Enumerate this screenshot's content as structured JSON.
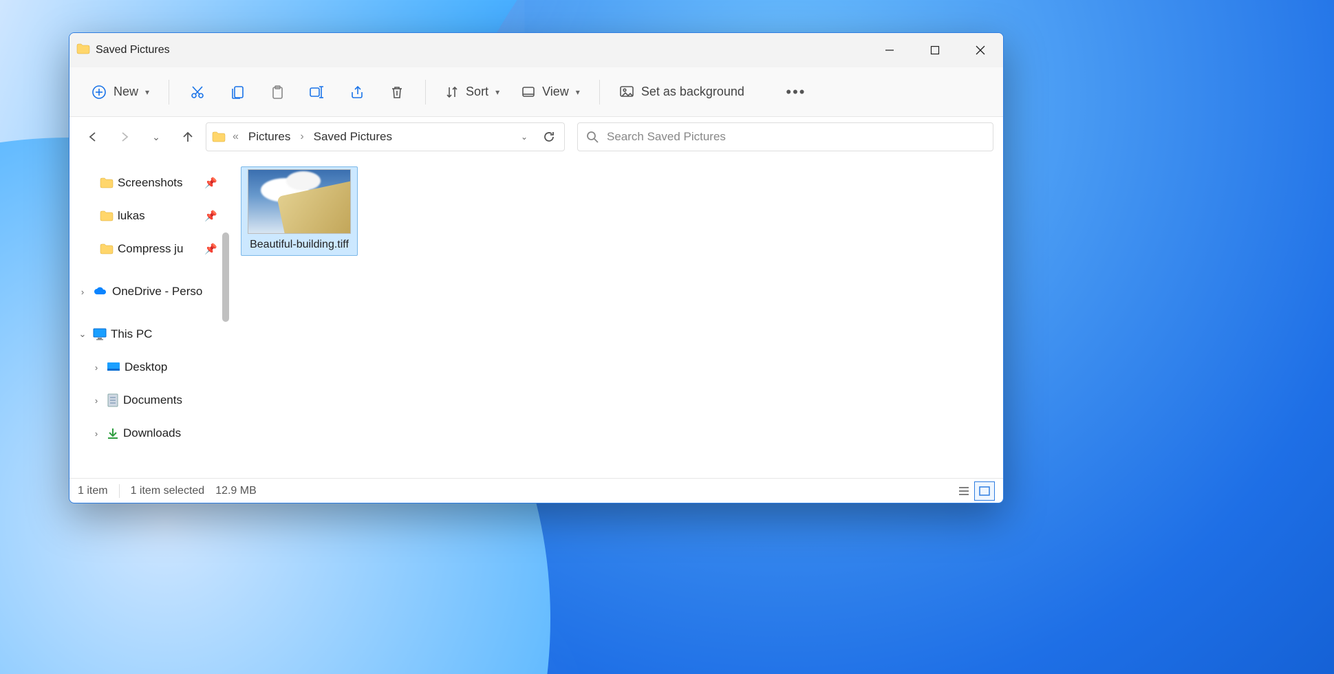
{
  "window": {
    "title": "Saved Pictures"
  },
  "toolbar": {
    "new_label": "New",
    "sort_label": "Sort",
    "view_label": "View",
    "set_bg_label": "Set as background"
  },
  "breadcrumbs": {
    "segments": [
      "Pictures",
      "Saved Pictures"
    ]
  },
  "search": {
    "placeholder": "Search Saved Pictures"
  },
  "nav": {
    "items": [
      {
        "label": "Screenshots",
        "type": "folder",
        "pinned": true,
        "indent": 1
      },
      {
        "label": "lukas",
        "type": "folder",
        "pinned": true,
        "indent": 1
      },
      {
        "label": "Compress ju",
        "type": "folder",
        "pinned": true,
        "indent": 1
      },
      {
        "label": "OneDrive - Perso",
        "type": "onedrive",
        "expander": "closed",
        "indent": 0
      },
      {
        "label": "This PC",
        "type": "thispc",
        "expander": "open",
        "indent": 0
      },
      {
        "label": "Desktop",
        "type": "desktop",
        "expander": "closed",
        "indent": 2
      },
      {
        "label": "Documents",
        "type": "documents",
        "expander": "closed",
        "indent": 2
      },
      {
        "label": "Downloads",
        "type": "downloads",
        "expander": "closed",
        "indent": 2
      }
    ]
  },
  "files": [
    {
      "name": "Beautiful-building.tiff",
      "selected": true
    }
  ],
  "status": {
    "items": "1 item",
    "selection": "1 item selected",
    "size": "12.9 MB"
  }
}
